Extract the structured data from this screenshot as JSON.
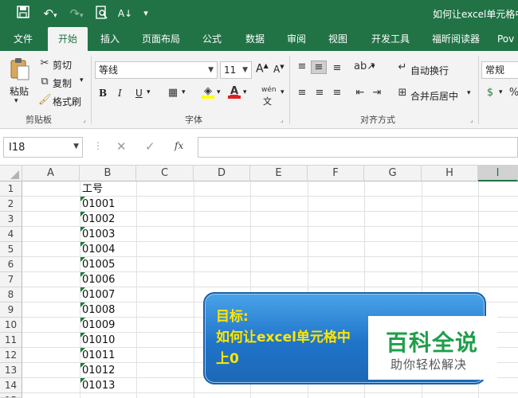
{
  "titlebar": {
    "title": "如何让excel单元格中",
    "icons": [
      "save-icon",
      "undo-icon",
      "redo-icon",
      "print-preview-icon",
      "sort-icon",
      "customize-icon"
    ]
  },
  "tabs": [
    "文件",
    "开始",
    "插入",
    "页面布局",
    "公式",
    "数据",
    "审阅",
    "视图",
    "开发工具",
    "福昕阅读器",
    "Pov"
  ],
  "active_tab": "开始",
  "ribbon": {
    "clipboard": {
      "paste": "粘贴",
      "cut": "剪切",
      "copy": "复制",
      "format_painter": "格式刷",
      "group": "剪贴板"
    },
    "font": {
      "name": "等线",
      "size": "11",
      "bold": "B",
      "italic": "I",
      "underline": "U",
      "grow": "A",
      "shrink": "A",
      "phonetic": "wén",
      "group": "字体"
    },
    "alignment": {
      "wrap": "自动换行",
      "merge": "合并后居中",
      "group": "对齐方式"
    },
    "number": {
      "format": "常规"
    }
  },
  "formula_bar": {
    "name_box": "I18",
    "fx": "fx",
    "content": ""
  },
  "columns": [
    "A",
    "B",
    "C",
    "D",
    "E",
    "F",
    "G",
    "H",
    "I"
  ],
  "rows": [
    "1",
    "2",
    "3",
    "4",
    "5",
    "6",
    "7",
    "8",
    "9",
    "10",
    "11",
    "12",
    "13",
    "14",
    "15"
  ],
  "cells": {
    "B1": "工号",
    "B": [
      "01001",
      "01002",
      "01003",
      "01004",
      "01005",
      "01006",
      "01007",
      "01008",
      "01009",
      "01010",
      "01011",
      "01012",
      "01013"
    ]
  },
  "overlay": {
    "line1": "目标:",
    "line2": "如何让excel单元格中",
    "line3": "上0"
  },
  "watermark": {
    "brand": "百科全说",
    "slogan": "助你轻松解决"
  },
  "colors": {
    "accent": "#217346",
    "bubble": "#1f74c9",
    "bubble_text": "#ffe600",
    "brand": "#1e9e4a"
  }
}
